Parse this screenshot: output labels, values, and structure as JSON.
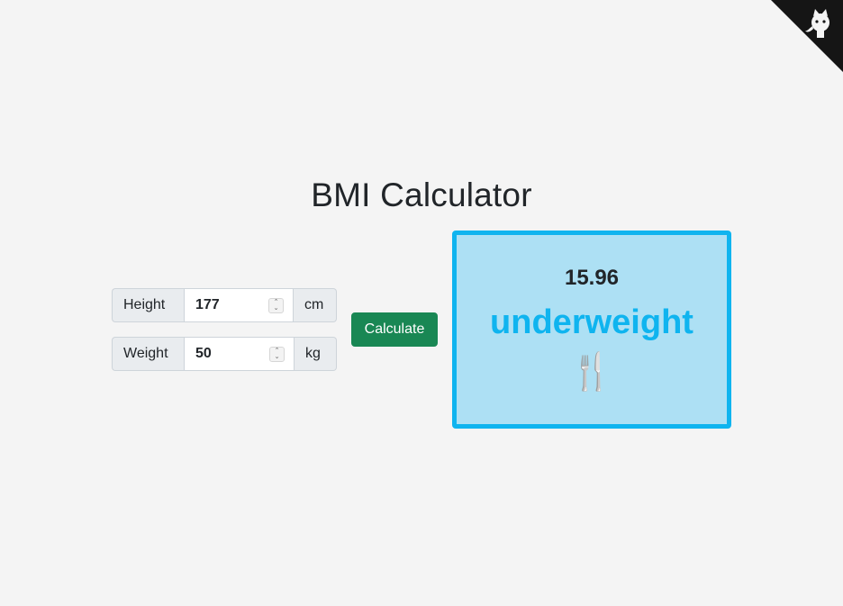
{
  "header": {
    "title": "BMI Calculator"
  },
  "form": {
    "height": {
      "label": "Height",
      "value": "177",
      "unit": "cm"
    },
    "weight": {
      "label": "Weight",
      "value": "50",
      "unit": "kg"
    },
    "calculate_label": "Calculate"
  },
  "result": {
    "bmi": "15.96",
    "category": "underweight",
    "emoji": "🍴"
  },
  "corner": {
    "icon": "github-icon"
  },
  "colors": {
    "background": "#f4f4f4",
    "button": "#198754",
    "result_border": "#0fb4ef",
    "result_background": "#ade0f4",
    "category_text": "#0fb4ef"
  }
}
